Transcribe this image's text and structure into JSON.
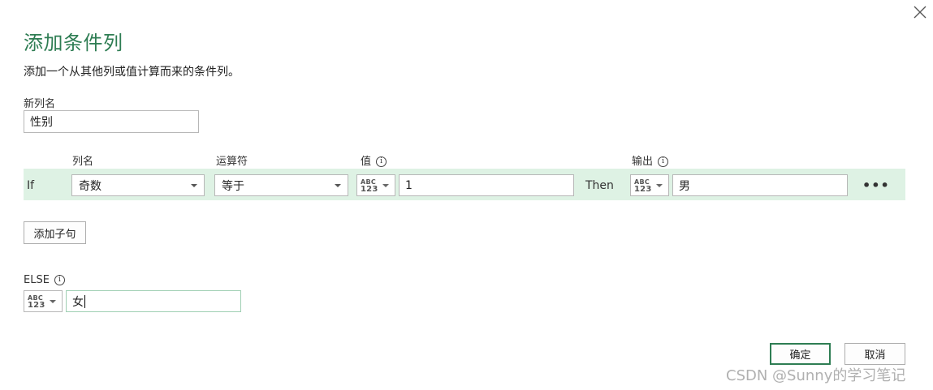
{
  "dialog": {
    "title": "添加条件列",
    "description": "添加一个从其他列或值计算而来的条件列。",
    "close_icon": "close-icon"
  },
  "new_column": {
    "label": "新列名",
    "value": "性别"
  },
  "headers": {
    "column_name": "列名",
    "operator": "运算符",
    "value": "值",
    "output": "输出"
  },
  "rule": {
    "if_label": "If",
    "column": "奇数",
    "operator": "等于",
    "type_top": "ABC",
    "type_bottom": "123",
    "value": "1",
    "then_label": "Then",
    "output": "男",
    "more_label": "•••"
  },
  "add_clause": "添加子句",
  "else": {
    "label": "ELSE",
    "value": "女"
  },
  "buttons": {
    "ok": "确定",
    "cancel": "取消"
  },
  "watermark": "CSDN @Sunny的学习笔记",
  "colors": {
    "accent": "#2e7d53",
    "row_highlight": "#def2e4"
  }
}
